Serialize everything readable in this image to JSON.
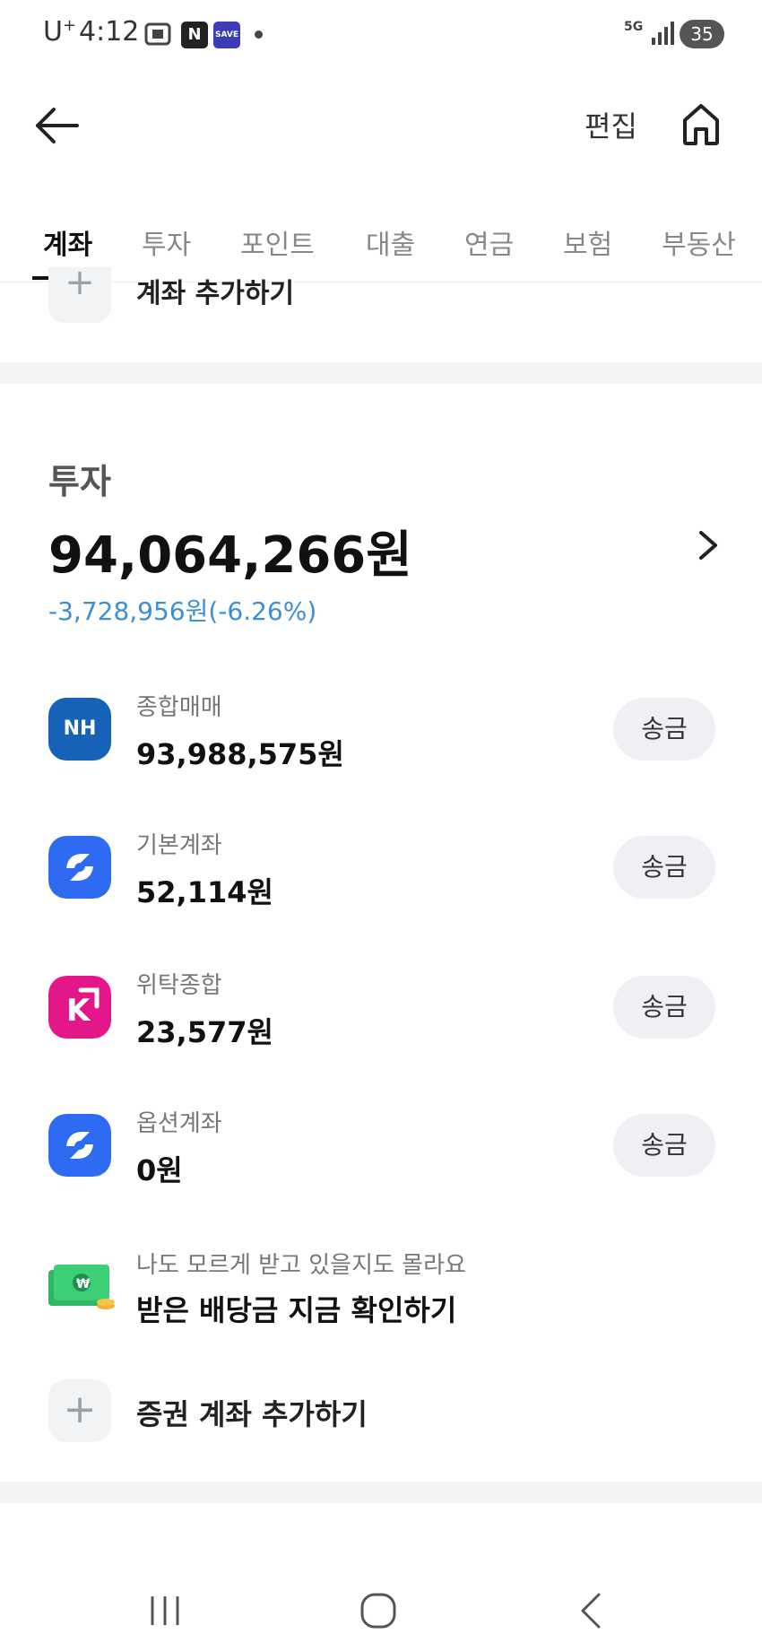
{
  "status_bar": {
    "carrier": "U",
    "carrier_plus": "+",
    "time": "4:12",
    "network": "5G",
    "battery": "35"
  },
  "header": {
    "edit_label": "편집"
  },
  "tabs": [
    {
      "label": "계좌",
      "active": true
    },
    {
      "label": "투자",
      "active": false
    },
    {
      "label": "포인트",
      "active": false
    },
    {
      "label": "대출",
      "active": false
    },
    {
      "label": "연금",
      "active": false
    },
    {
      "label": "보험",
      "active": false
    },
    {
      "label": "부동산",
      "active": false
    }
  ],
  "add_account_top": {
    "label": "계좌 추가하기"
  },
  "investment": {
    "title": "투자",
    "total": "94,064,266원",
    "change": "-3,728,956원(-6.26%)",
    "accounts": [
      {
        "name": "종합매매",
        "balance": "93,988,575원",
        "button": "송금",
        "logo": "nh-logo",
        "logo_text": "NH",
        "color": "#1562b8"
      },
      {
        "name": "기본계좌",
        "balance": "52,114원",
        "button": "송금",
        "logo": "toss-logo",
        "color": "#2f6bf2"
      },
      {
        "name": "위탁종합",
        "balance": "23,577원",
        "button": "송금",
        "logo": "kiwoom-logo",
        "color": "#e4178a"
      },
      {
        "name": "옵션계좌",
        "balance": "0원",
        "button": "송금",
        "logo": "toss-logo",
        "color": "#2f6bf2"
      }
    ]
  },
  "dividend": {
    "subtitle": "나도 모르게 받고 있을지도 몰라요",
    "title": "받은 배당금 지금 확인하기"
  },
  "add_securities": {
    "label": "증권 계좌 추가하기"
  },
  "colors": {
    "accent_blue": "#3b8fd6",
    "send_bg": "#eef0f3",
    "divider": "#f2f4f6"
  }
}
